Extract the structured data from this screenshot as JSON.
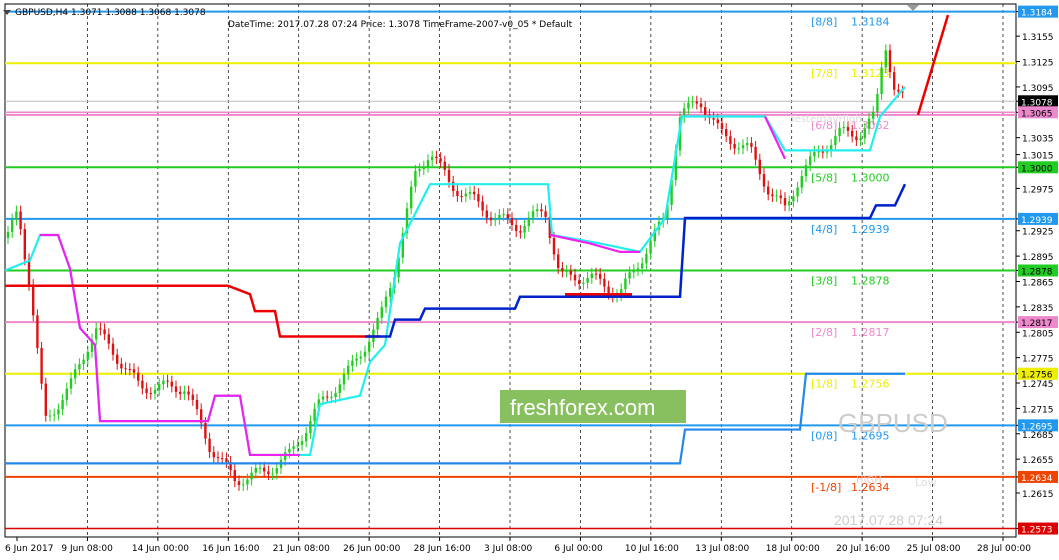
{
  "symbol_header": "GBPUSD,H4  1.3071 1.3088 1.3068 1.3078",
  "info_bar": "DateTime: 2017.07.28 07:24    Price: 1.3078    TimeFrame-2007-v0_05    *  Default",
  "watermark": {
    "brand": "freshforex.com",
    "symbol": "GBPUSD",
    "datetime": "2017.07.28 07:24"
  },
  "labels": {
    "yesterday_high": "YesterdayHigh",
    "yesterday_low": "Low",
    "hi": "HIGH",
    "lo": "Low"
  },
  "colors": {
    "up_candle": "#22cc22",
    "down_candle": "#dd1111",
    "cyan_line": "#22eeee",
    "magenta_line": "#ee22ee",
    "blue_line": "#0022cc",
    "red_line": "#ee0000",
    "lightblue_line": "#2288ee",
    "brand_box": "#88c060"
  },
  "chart_data": {
    "type": "candlestick",
    "y_range": [
      1.2563,
      1.3193
    ],
    "y_ticks": [
      "1.3184",
      "1.3155",
      "1.3125",
      "1.3095",
      "1.3078",
      "1.3065",
      "1.3035",
      "1.3015",
      "1.3000",
      "1.2975",
      "1.2939",
      "1.2925",
      "1.2895",
      "1.2878",
      "1.2865",
      "1.2835",
      "1.2817",
      "1.2805",
      "1.2775",
      "1.2756",
      "1.2745",
      "1.2715",
      "1.2695",
      "1.2685",
      "1.2655",
      "1.2634",
      "1.2615",
      "1.2573"
    ],
    "x_labels": [
      "6 Jun 2017",
      "9 Jun 08:00",
      "14 Jun 00:00",
      "16 Jun 16:00",
      "21 Jun 08:00",
      "26 Jun 00:00",
      "28 Jun 16:00",
      "3 Jul 08:00",
      "6 Jul 00:00",
      "10 Jul 16:00",
      "13 Jul 08:00",
      "18 Jul 00:00",
      "20 Jul 16:00",
      "25 Jul 08:00",
      "28 Jul 00:00"
    ],
    "current_price": "1.3078",
    "murrey_levels": [
      {
        "name": "[8/8]",
        "value": "1.3184",
        "color": "#2299ee"
      },
      {
        "name": "[7/8]",
        "value": "1.3123",
        "color": "#eeee00"
      },
      {
        "name": "[6/8]",
        "value": "1.3062",
        "color": "#ee88cc"
      },
      {
        "name": "[5/8]",
        "value": "1.3000",
        "color": "#22cc22"
      },
      {
        "name": "[4/8]",
        "value": "1.2939",
        "color": "#2299ee"
      },
      {
        "name": "[3/8]",
        "value": "1.2878",
        "color": "#22cc22"
      },
      {
        "name": "[2/8]",
        "value": "1.2817",
        "color": "#ee88cc"
      },
      {
        "name": "[1/8]",
        "value": "1.2756",
        "color": "#eeee00"
      },
      {
        "name": "[0/8]",
        "value": "1.2695",
        "color": "#2299ee"
      },
      {
        "name": "[-1/8]",
        "value": "1.2634",
        "color": "#ee4400"
      }
    ],
    "extra_lines": [
      {
        "value": "1.3065",
        "color": "#ee88cc"
      },
      {
        "value": "1.2573",
        "color": "#dd0000"
      }
    ]
  }
}
